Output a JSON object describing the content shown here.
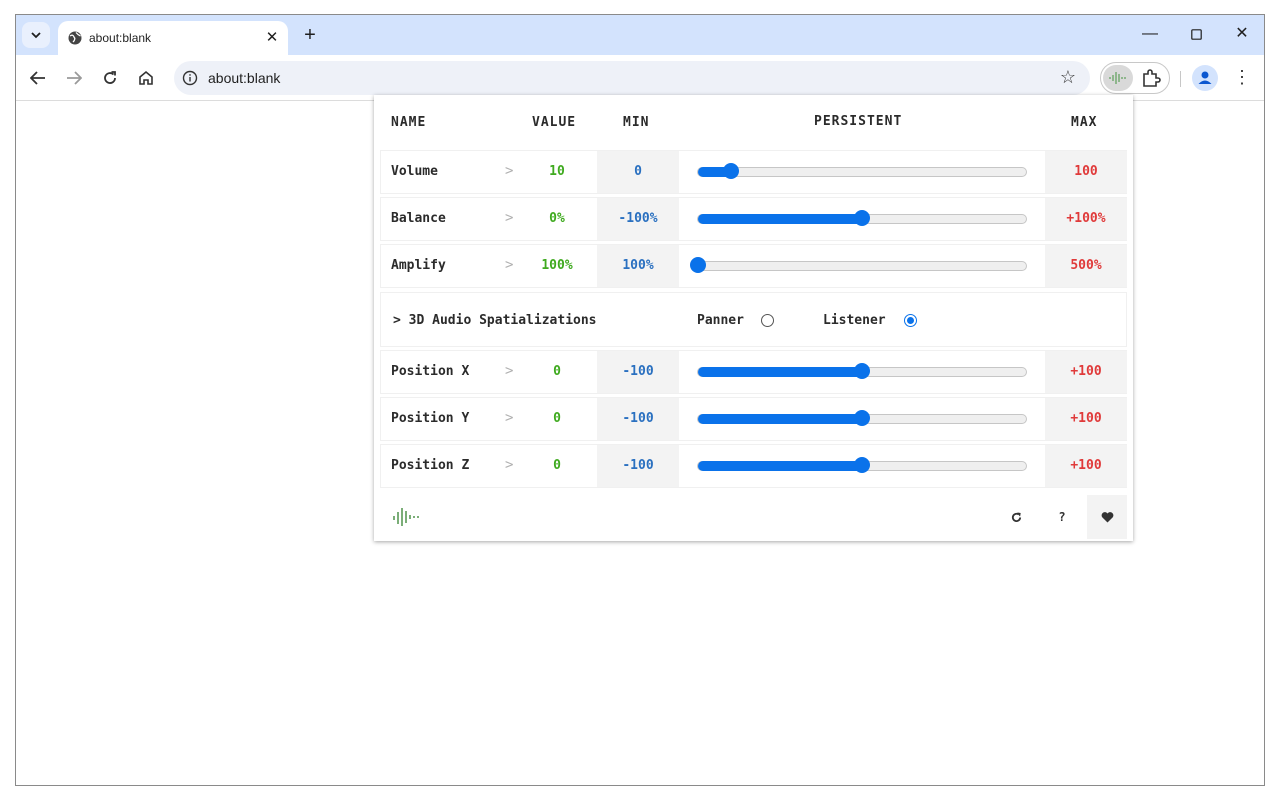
{
  "browser": {
    "tab_title": "about:blank",
    "url": "about:blank",
    "icons": {
      "tab_search": "chevron-down-icon",
      "tab_favicon": "globe-icon",
      "tab_close": "close-icon",
      "new_tab": "plus-icon",
      "back": "arrow-left-icon",
      "forward": "arrow-right-icon",
      "reload": "reload-icon",
      "home": "home-icon",
      "site_info": "info-icon",
      "bookmark": "star-icon",
      "extension": "audio-wave-icon",
      "extensions_menu": "puzzle-icon",
      "profile": "person-icon",
      "menu": "kebab-icon",
      "minimize": "minimize-icon",
      "maximize": "maximize-icon",
      "close_window": "close-icon"
    }
  },
  "popup": {
    "headers": {
      "name": "NAME",
      "value": "VALUE",
      "min": "MIN",
      "persistent": "PERSISTENT",
      "max": "MAX"
    },
    "rows_top": [
      {
        "name": "Volume",
        "value": "10",
        "min": "0",
        "max": "100",
        "level": 0.1
      },
      {
        "name": "Balance",
        "value": "0%",
        "min": "-100%",
        "max": "+100%",
        "level": 0.5
      },
      {
        "name": "Amplify",
        "value": "100%",
        "min": "100%",
        "max": "500%",
        "level": 0.0
      }
    ],
    "spatial": {
      "label": "3D Audio Spatializations",
      "panner_label": "Panner",
      "listener_label": "Listener",
      "selected": "Listener"
    },
    "rows_bottom": [
      {
        "name": "Position X",
        "value": "0",
        "min": "-100",
        "max": "+100",
        "level": 0.5
      },
      {
        "name": "Position Y",
        "value": "0",
        "min": "-100",
        "max": "+100",
        "level": 0.5
      },
      {
        "name": "Position Z",
        "value": "0",
        "min": "-100",
        "max": "+100",
        "level": 0.5
      }
    ],
    "footer": {
      "reset_icon": "reset-icon",
      "help_label": "?",
      "heart_icon": "heart-icon"
    },
    "colors": {
      "value": "#3faa1f",
      "min": "#2a70c0",
      "max": "#e03a3a",
      "accent": "#0a72ea"
    }
  }
}
